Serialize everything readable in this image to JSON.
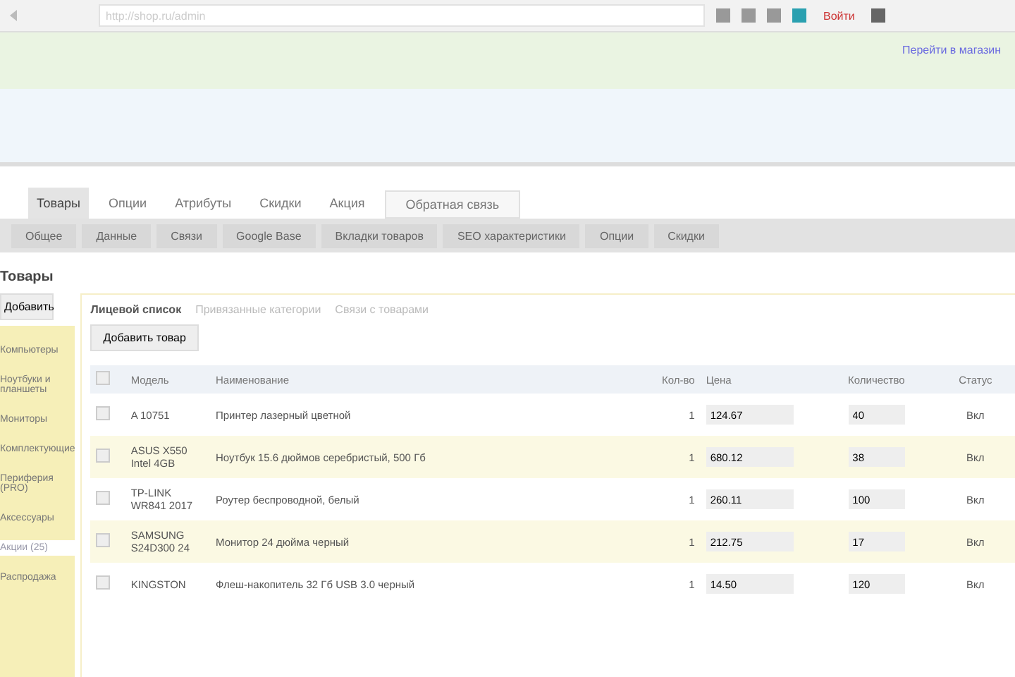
{
  "browser": {
    "url_hint": "http://shop.ru/admin",
    "buttons": [
      "Войти"
    ]
  },
  "store_link": "Перейти в магазин",
  "tabs": [
    {
      "label": "Товары",
      "selected": true
    },
    {
      "label": "Опции",
      "selected": false
    },
    {
      "label": "Атрибуты",
      "selected": false
    },
    {
      "label": "Скидки",
      "selected": false
    },
    {
      "label": "Акция",
      "selected": false
    },
    {
      "label": "Обратная связь",
      "selected": false
    }
  ],
  "subtabs": [
    "Общее",
    "Данные",
    "Связи",
    "Google Base",
    "Вкладки товаров",
    "SEO характеристики",
    "Опции",
    "Скидки"
  ],
  "heading": "Товары",
  "add_button": "Добавить",
  "sidebar": [
    {
      "label": "Компьютеры",
      "selected": false
    },
    {
      "label": "Ноутбуки и планшеты",
      "selected": false
    },
    {
      "label": "Мониторы",
      "selected": false
    },
    {
      "label": "Комплектующие",
      "selected": false
    },
    {
      "label": "Периферия (PRO)",
      "selected": false
    },
    {
      "label": "Аксессуары",
      "selected": false
    },
    {
      "label": "Акции (25)",
      "selected": true
    },
    {
      "label": "Распродажа",
      "selected": false
    }
  ],
  "panel_tabs": [
    {
      "label": "Лицевой список",
      "selected": true
    },
    {
      "label": "Привязанные категории",
      "selected": false
    },
    {
      "label": "Связи с товарами",
      "selected": false
    }
  ],
  "add_product_button": "Добавить товар",
  "table": {
    "columns": [
      "Модель",
      "Наименование",
      "Кол-во",
      "Цена",
      "Количество",
      "Статус"
    ],
    "all_checked": false,
    "rows": [
      {
        "model": "A 10751",
        "name": "Принтер лазерный цветной",
        "qty": "1",
        "checked": false,
        "price": "124.67",
        "count": "40",
        "status": "Вкл"
      },
      {
        "model": "ASUS X550 Intel 4GB",
        "name": "Ноутбук 15.6 дюймов серебристый, 500 Гб",
        "qty": "1",
        "checked": false,
        "price": "680.12",
        "count": "38",
        "status": "Вкл"
      },
      {
        "model": "TP-LINK WR841 2017",
        "name": "Роутер беспроводной, белый",
        "qty": "1",
        "checked": false,
        "price": "260.11",
        "count": "100",
        "status": "Вкл"
      },
      {
        "model": "SAMSUNG S24D300 24",
        "name": "Монитор 24 дюйма черный",
        "qty": "1",
        "checked": false,
        "price": "212.75",
        "count": "17",
        "status": "Вкл"
      },
      {
        "model": "KINGSTON",
        "name": "Флеш-накопитель 32 Гб USB 3.0 черный",
        "qty": "1",
        "checked": false,
        "price": "14.50",
        "count": "120",
        "status": "Вкл"
      }
    ]
  }
}
